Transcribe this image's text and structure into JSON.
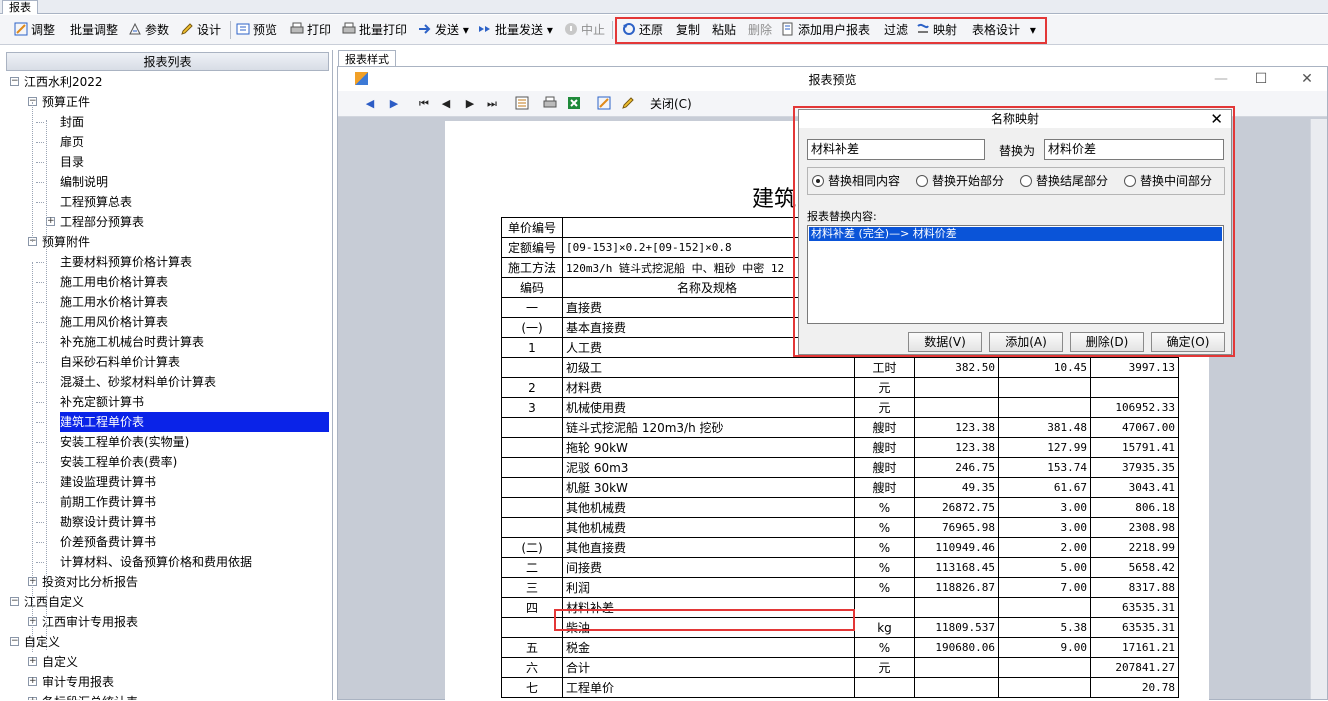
{
  "top_tab": "报表",
  "toolbar": {
    "adjust": "调整",
    "batch_adjust": "批量调整",
    "params": "参数",
    "design": "设计",
    "preview": "预览",
    "print": "打印",
    "batch_print": "批量打印",
    "send": "发送",
    "batch_send": "批量发送",
    "stop": "中止",
    "restore": "还原",
    "copy": "复制",
    "paste": "粘贴",
    "delete": "删除",
    "add_user_report": "添加用户报表",
    "filter": "过滤",
    "mapping": "映射",
    "table_design": "表格设计"
  },
  "left_panel": {
    "header": "报表列表"
  },
  "tree": [
    {
      "label": "江西水利2022",
      "level": 0,
      "expander": "−"
    },
    {
      "label": "预算正件",
      "level": 1,
      "expander": "−"
    },
    {
      "label": "封面",
      "level": 2
    },
    {
      "label": "扉页",
      "level": 2
    },
    {
      "label": "目录",
      "level": 2
    },
    {
      "label": "编制说明",
      "level": 2
    },
    {
      "label": "工程预算总表",
      "level": 2
    },
    {
      "label": "工程部分预算表",
      "level": 2,
      "expander": "+"
    },
    {
      "label": "预算附件",
      "level": 1,
      "expander": "−"
    },
    {
      "label": "主要材料预算价格计算表",
      "level": 2
    },
    {
      "label": "施工用电价格计算表",
      "level": 2
    },
    {
      "label": "施工用水价格计算表",
      "level": 2
    },
    {
      "label": "施工用风价格计算表",
      "level": 2
    },
    {
      "label": "补充施工机械台时费计算表",
      "level": 2
    },
    {
      "label": "自采砂石料单价计算表",
      "level": 2
    },
    {
      "label": "混凝土、砂浆材料单价计算表",
      "level": 2
    },
    {
      "label": "补充定额计算书",
      "level": 2
    },
    {
      "label": "建筑工程单价表",
      "level": 2,
      "selected": true
    },
    {
      "label": "安装工程单价表(实物量)",
      "level": 2
    },
    {
      "label": "安装工程单价表(费率)",
      "level": 2
    },
    {
      "label": "建设监理费计算书",
      "level": 2
    },
    {
      "label": "前期工作费计算书",
      "level": 2
    },
    {
      "label": "勘察设计费计算书",
      "level": 2
    },
    {
      "label": "价差预备费计算书",
      "level": 2
    },
    {
      "label": "计算材料、设备预算价格和费用依据",
      "level": 2
    },
    {
      "label": "投资对比分析报告",
      "level": 1,
      "expander": "+"
    },
    {
      "label": "江西自定义",
      "level": 0,
      "expander": "−"
    },
    {
      "label": "江西审计专用报表",
      "level": 1,
      "expander": "+"
    },
    {
      "label": "自定义",
      "level": 0,
      "expander": "−"
    },
    {
      "label": "自定义",
      "level": 1,
      "expander": "+"
    },
    {
      "label": "审计专用报表",
      "level": 1,
      "expander": "+"
    },
    {
      "label": "各标段汇总统计表",
      "level": 1,
      "expander": "+"
    }
  ],
  "report_tab": "报表样式",
  "preview_window": {
    "title": "报表预览",
    "close_label": "关闭(C)",
    "page_title": "建筑"
  },
  "report": {
    "header_rows": [
      {
        "label": "单价编号",
        "value": ""
      },
      {
        "label": "定额编号",
        "value": "[09-153]×0.2+[09-152]×0.8"
      },
      {
        "label": "施工方法",
        "value": "120m3/h 链斗式挖泥船 中、粗砂 中密 12"
      }
    ],
    "col_headers": {
      "code": "编码",
      "name": "名称及规格"
    },
    "rows": [
      {
        "code": "一",
        "name": "直接费",
        "unit": "",
        "qty": "",
        "price": "",
        "total": ""
      },
      {
        "code": "(一)",
        "name": "基本直接费",
        "unit": "",
        "qty": "",
        "price": "",
        "total": ""
      },
      {
        "code": "1",
        "name": "人工费",
        "unit": "",
        "qty": "",
        "price": "",
        "total": ""
      },
      {
        "code": "",
        "name": "初级工",
        "unit": "工时",
        "qty": "382.50",
        "price": "10.45",
        "total": "3997.13"
      },
      {
        "code": "2",
        "name": "材料费",
        "unit": "元",
        "qty": "",
        "price": "",
        "total": ""
      },
      {
        "code": "3",
        "name": "机械使用费",
        "unit": "元",
        "qty": "",
        "price": "",
        "total": "106952.33"
      },
      {
        "code": "",
        "name": "链斗式挖泥船 120m3/h 挖砂",
        "unit": "艘时",
        "qty": "123.38",
        "price": "381.48",
        "total": "47067.00"
      },
      {
        "code": "",
        "name": "拖轮 90kW",
        "unit": "艘时",
        "qty": "123.38",
        "price": "127.99",
        "total": "15791.41"
      },
      {
        "code": "",
        "name": "泥驳 60m3",
        "unit": "艘时",
        "qty": "246.75",
        "price": "153.74",
        "total": "37935.35"
      },
      {
        "code": "",
        "name": "机艇 30kW",
        "unit": "艘时",
        "qty": "49.35",
        "price": "61.67",
        "total": "3043.41"
      },
      {
        "code": "",
        "name": "其他机械费",
        "unit": "%",
        "qty": "26872.75",
        "price": "3.00",
        "total": "806.18"
      },
      {
        "code": "",
        "name": "其他机械费",
        "unit": "%",
        "qty": "76965.98",
        "price": "3.00",
        "total": "2308.98"
      },
      {
        "code": "(二)",
        "name": "其他直接费",
        "unit": "%",
        "qty": "110949.46",
        "price": "2.00",
        "total": "2218.99"
      },
      {
        "code": "二",
        "name": "间接费",
        "unit": "%",
        "qty": "113168.45",
        "price": "5.00",
        "total": "5658.42"
      },
      {
        "code": "三",
        "name": "利润",
        "unit": "%",
        "qty": "118826.87",
        "price": "7.00",
        "total": "8317.88"
      },
      {
        "code": "四",
        "name": "材料补差",
        "unit": "",
        "qty": "",
        "price": "",
        "total": "63535.31"
      },
      {
        "code": "",
        "name": "柴油",
        "unit": "kg",
        "qty": "11809.537",
        "price": "5.38",
        "total": "63535.31"
      },
      {
        "code": "五",
        "name": "税金",
        "unit": "%",
        "qty": "190680.06",
        "price": "9.00",
        "total": "17161.21"
      },
      {
        "code": "六",
        "name": "合计",
        "unit": "元",
        "qty": "",
        "price": "",
        "total": "207841.27"
      },
      {
        "code": "七",
        "name": "工程单价",
        "unit": "",
        "qty": "",
        "price": "",
        "total": "20.78"
      }
    ]
  },
  "dialog": {
    "title": "名称映射",
    "source_value": "材料补差",
    "replace_as_label": "替换为",
    "target_value": "材料价差",
    "radio_options": [
      "替换相同内容",
      "替换开始部分",
      "替换结尾部分",
      "替换中间部分"
    ],
    "selected_radio": 0,
    "list_label": "报表替换内容:",
    "list_items": [
      "材料补差 (完全)—> 材料价差"
    ],
    "buttons": {
      "data": "数据(V)",
      "add": "添加(A)",
      "delete": "删除(D)",
      "ok": "确定(O)"
    }
  },
  "colors": {
    "highlight_box": "#e33737",
    "selection": "#0a23e8"
  }
}
